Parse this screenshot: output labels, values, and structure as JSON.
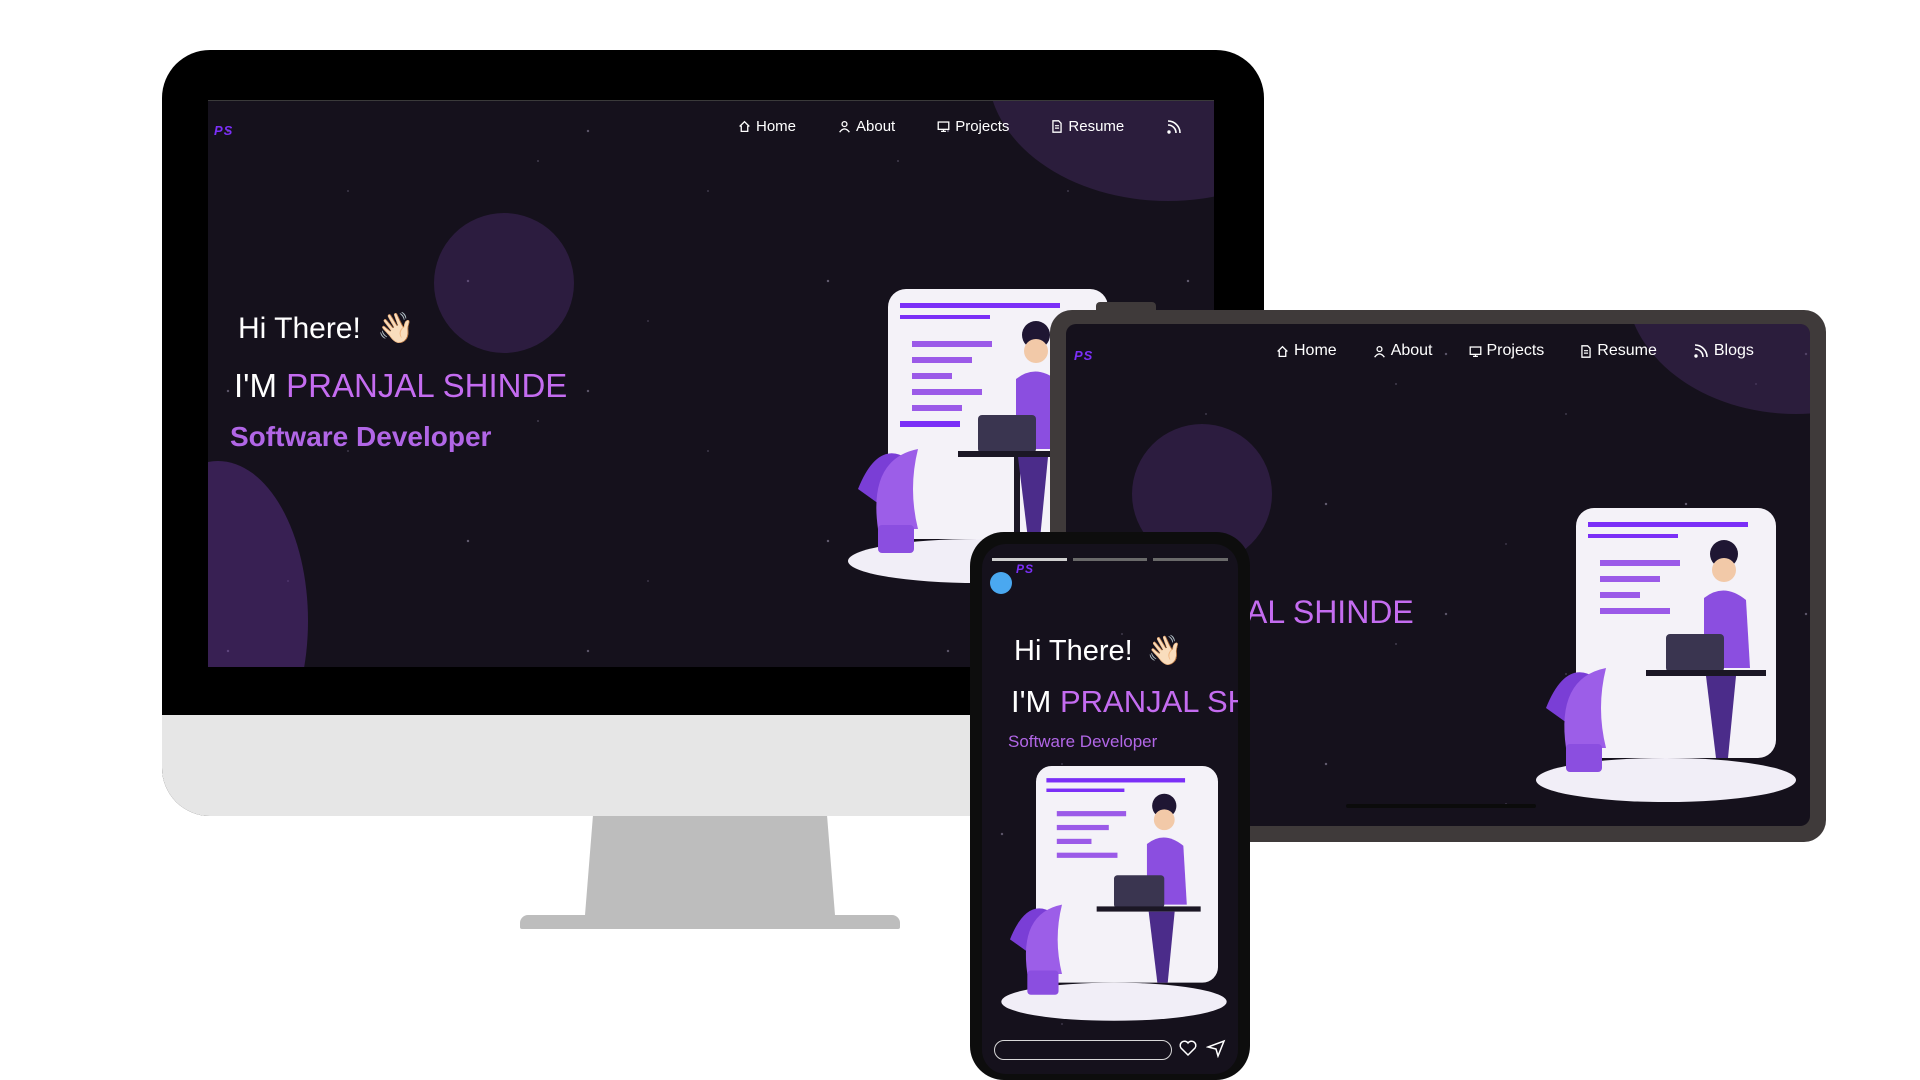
{
  "site": {
    "logo": "PS",
    "nav": [
      {
        "label": "Home",
        "icon": "home-icon"
      },
      {
        "label": "About",
        "icon": "user-icon"
      },
      {
        "label": "Projects",
        "icon": "projects-icon"
      },
      {
        "label": "Resume",
        "icon": "document-icon"
      },
      {
        "label": "Blogs",
        "icon": "rss-icon"
      }
    ],
    "greeting": "Hi There!",
    "wave_emoji": "👋🏻",
    "im_prefix": "I'M",
    "name": "PRANJAL SHINDE",
    "tablet_name_partial": "AL SHINDE",
    "phone_name_partial": "PRANJAL SH",
    "role": "Software Developer"
  },
  "colors": {
    "background": "#15111c",
    "accent": "#c46cf0",
    "logo": "#7b2ff7",
    "role": "#b166e6",
    "monitor_bezel": "#000000",
    "monitor_chin": "#e6e6e6",
    "stand": "#bdbdbd",
    "tablet_frame": "#3f3a3a",
    "phone_frame": "#0d0d0d"
  },
  "devices": [
    "desktop-monitor",
    "tablet",
    "phone"
  ]
}
